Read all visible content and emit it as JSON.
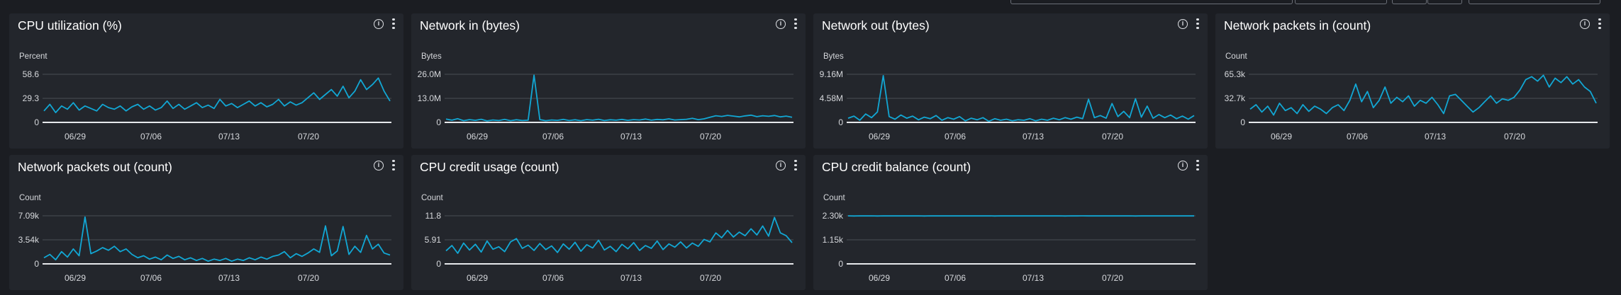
{
  "colors": {
    "line": "#12a7d4",
    "grid": "#4a4e55",
    "axis": "#e6e8eb"
  },
  "icons": {
    "info": "info-icon",
    "menu": "more-vertical-icon"
  },
  "panels": [
    {
      "title": "CPU utilization (%)",
      "unit": "Percent",
      "yticks": [
        "58.6",
        "29.3",
        "0"
      ],
      "xticks": [
        "06/29",
        "07/06",
        "07/13",
        "07/20"
      ]
    },
    {
      "title": "Network in (bytes)",
      "unit": "Bytes",
      "yticks": [
        "26.0M",
        "13.0M",
        "0"
      ],
      "xticks": [
        "06/29",
        "07/06",
        "07/13",
        "07/20"
      ]
    },
    {
      "title": "Network out (bytes)",
      "unit": "Bytes",
      "yticks": [
        "9.16M",
        "4.58M",
        "0"
      ],
      "xticks": [
        "06/29",
        "07/06",
        "07/13",
        "07/20"
      ]
    },
    {
      "title": "Network packets in (count)",
      "unit": "Count",
      "yticks": [
        "65.3k",
        "32.7k",
        "0"
      ],
      "xticks": [
        "06/29",
        "07/06",
        "07/13",
        "07/20"
      ]
    },
    {
      "title": "Network packets out (count)",
      "unit": "Count",
      "yticks": [
        "7.09k",
        "3.54k",
        "0"
      ],
      "xticks": [
        "06/29",
        "07/06",
        "07/13",
        "07/20"
      ]
    },
    {
      "title": "CPU credit usage (count)",
      "unit": "Count",
      "yticks": [
        "11.8",
        "5.91",
        "0"
      ],
      "xticks": [
        "06/29",
        "07/06",
        "07/13",
        "07/20"
      ]
    },
    {
      "title": "CPU credit balance (count)",
      "unit": "Count",
      "yticks": [
        "2.30k",
        "1.15k",
        "0"
      ],
      "xticks": [
        "06/29",
        "07/06",
        "07/13",
        "07/20"
      ]
    }
  ],
  "chart_data": [
    {
      "type": "line",
      "title": "CPU utilization (%)",
      "ylabel": "Percent",
      "ylim": [
        0,
        58.6
      ],
      "x": [
        "06/29",
        "07/06",
        "07/13",
        "07/20"
      ],
      "series": [
        {
          "values": [
            14,
            22,
            12,
            20,
            16,
            24,
            15,
            20,
            17,
            14,
            22,
            18,
            16,
            20,
            14,
            19,
            22,
            16,
            20,
            15,
            18,
            26,
            17,
            22,
            16,
            20,
            24,
            18,
            21,
            17,
            28,
            20,
            23,
            18,
            22,
            26,
            20,
            24,
            19,
            22,
            28,
            20,
            25,
            21,
            24,
            30,
            36,
            28,
            34,
            40,
            32,
            44,
            30,
            38,
            52,
            40,
            46,
            54,
            38,
            26
          ]
        }
      ]
    },
    {
      "type": "line",
      "title": "Network in (bytes)",
      "ylabel": "Bytes",
      "ylim": [
        0,
        26000000
      ],
      "x": [
        "06/29",
        "07/06",
        "07/13",
        "07/20"
      ],
      "series": [
        {
          "values": [
            1800000,
            1200000,
            2000000,
            900000,
            1500000,
            1100000,
            1700000,
            800000,
            1300000,
            1000000,
            1600000,
            900000,
            1400000,
            1000000,
            1200000,
            25500000,
            1500000,
            900000,
            1300000,
            1100000,
            1600000,
            1000000,
            1400000,
            900000,
            1500000,
            1200000,
            1700000,
            1000000,
            1400000,
            1200000,
            1600000,
            1100000,
            1500000,
            1300000,
            1800000,
            1200000,
            1600000,
            1400000,
            1900000,
            1300000,
            1500000,
            1700000,
            2200000,
            1500000,
            1900000,
            2800000,
            3600000,
            3200000,
            3800000,
            3400000,
            3000000,
            3500000,
            3900000,
            3100000,
            3600000,
            3300000,
            3700000,
            3000000,
            3400000,
            2800000
          ]
        }
      ]
    },
    {
      "type": "line",
      "title": "Network out (bytes)",
      "ylabel": "Bytes",
      "ylim": [
        0,
        9160000
      ],
      "x": [
        "06/29",
        "07/06",
        "07/13",
        "07/20"
      ],
      "series": [
        {
          "values": [
            800000,
            1200000,
            400000,
            1600000,
            900000,
            2000000,
            8900000,
            1100000,
            600000,
            1400000,
            800000,
            1200000,
            500000,
            1000000,
            700000,
            1300000,
            400000,
            900000,
            600000,
            1100000,
            300000,
            800000,
            500000,
            900000,
            200000,
            700000,
            400000,
            600000,
            300000,
            500000,
            400000,
            700000,
            300000,
            600000,
            400000,
            800000,
            500000,
            900000,
            600000,
            1000000,
            700000,
            4400000,
            900000,
            1300000,
            800000,
            3600000,
            1100000,
            2100000,
            900000,
            4500000,
            1000000,
            3100000,
            800000,
            1500000,
            900000,
            1400000,
            700000,
            1200000,
            600000,
            1300000
          ]
        }
      ]
    },
    {
      "type": "line",
      "title": "Network packets in (count)",
      "ylabel": "Count",
      "ylim": [
        0,
        65300
      ],
      "x": [
        "06/29",
        "07/06",
        "07/13",
        "07/20"
      ],
      "series": [
        {
          "values": [
            18000,
            24000,
            14000,
            22000,
            10000,
            26000,
            16000,
            20000,
            12000,
            24000,
            15000,
            22000,
            18000,
            12000,
            20000,
            24000,
            16000,
            30000,
            52000,
            28000,
            42000,
            20000,
            30000,
            48000,
            26000,
            34000,
            28000,
            36000,
            22000,
            30000,
            26000,
            34000,
            24000,
            12000,
            36000,
            38000,
            30000,
            22000,
            14000,
            20000,
            28000,
            36000,
            26000,
            32000,
            30000,
            34000,
            44000,
            58000,
            62000,
            56000,
            64000,
            48000,
            60000,
            54000,
            62000,
            52000,
            58000,
            48000,
            42000,
            26000
          ]
        }
      ]
    },
    {
      "type": "line",
      "title": "Network packets out (count)",
      "ylabel": "Count",
      "ylim": [
        0,
        7090
      ],
      "x": [
        "06/29",
        "07/06",
        "07/13",
        "07/20"
      ],
      "series": [
        {
          "values": [
            900,
            1400,
            600,
            1800,
            1000,
            2200,
            1200,
            6900,
            1500,
            1900,
            2400,
            2000,
            2600,
            1800,
            2200,
            1400,
            900,
            1200,
            700,
            1000,
            600,
            1300,
            800,
            1100,
            600,
            900,
            500,
            800,
            400,
            700,
            500,
            800,
            400,
            700,
            500,
            900,
            600,
            1000,
            700,
            1100,
            1300,
            1800,
            900,
            1500,
            1100,
            1600,
            2200,
            1700,
            5600,
            1200,
            1900,
            5500,
            1400,
            2600,
            1700,
            4200,
            2200,
            2900,
            1600,
            1300
          ]
        }
      ]
    },
    {
      "type": "line",
      "title": "CPU credit usage (count)",
      "ylabel": "Count",
      "ylim": [
        0,
        11.8
      ],
      "x": [
        "06/29",
        "07/06",
        "07/13",
        "07/20"
      ],
      "series": [
        {
          "values": [
            3.2,
            4.5,
            2.6,
            5.1,
            3.4,
            4.8,
            2.9,
            5.6,
            3.6,
            4.2,
            3.0,
            5.4,
            6.2,
            3.8,
            4.6,
            3.3,
            5.0,
            3.5,
            4.4,
            2.8,
            4.9,
            3.6,
            5.3,
            3.1,
            4.7,
            3.9,
            5.8,
            3.4,
            4.3,
            3.0,
            4.8,
            3.7,
            5.2,
            3.3,
            4.5,
            3.8,
            5.6,
            3.5,
            4.9,
            4.1,
            5.4,
            3.9,
            5.1,
            4.3,
            6.0,
            5.4,
            7.6,
            6.4,
            8.2,
            6.6,
            7.8,
            6.9,
            8.6,
            7.1,
            9.3,
            6.8,
            11.4,
            7.6,
            6.9,
            5.2
          ]
        }
      ]
    },
    {
      "type": "line",
      "title": "CPU credit balance (count)",
      "ylabel": "Count",
      "ylim": [
        0,
        2300
      ],
      "x": [
        "06/29",
        "07/06",
        "07/13",
        "07/20"
      ],
      "series": [
        {
          "values": [
            2295,
            2290,
            2296,
            2292,
            2295,
            2291,
            2296,
            2293,
            2295,
            2292,
            2296,
            2294,
            2295,
            2291,
            2296,
            2293,
            2295,
            2292,
            2296,
            2294,
            2295,
            2292,
            2296,
            2293,
            2295,
            2291,
            2296,
            2294,
            2295,
            2292,
            2296,
            2293,
            2295,
            2292,
            2296,
            2294,
            2295,
            2291,
            2296,
            2293,
            2295,
            2292,
            2296,
            2294,
            2295,
            2292,
            2296,
            2293,
            2295,
            2291,
            2296,
            2294,
            2295,
            2292,
            2296,
            2293,
            2295,
            2292,
            2296,
            2294
          ]
        }
      ]
    }
  ]
}
